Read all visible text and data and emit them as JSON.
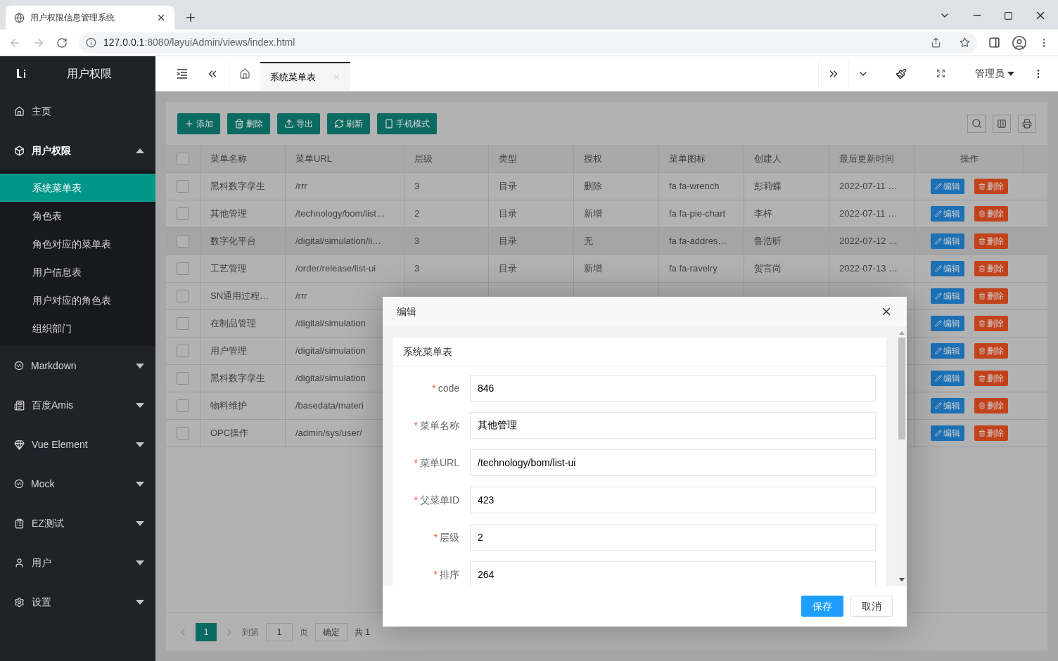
{
  "browser": {
    "tab_title": "用户权限信息管理系统",
    "url_host": "127.0.0.1",
    "url_path": ":8080/layuiAdmin/views/index.html"
  },
  "sidebar": {
    "title": "用户权限",
    "items": [
      {
        "label": "主页",
        "kind": "link"
      },
      {
        "label": "用户权限",
        "kind": "group",
        "expanded": true,
        "children": [
          {
            "label": "系统菜单表",
            "selected": true
          },
          {
            "label": "角色表",
            "selected": false
          },
          {
            "label": "角色对应的菜单表",
            "selected": false
          },
          {
            "label": "用户信息表",
            "selected": false
          },
          {
            "label": "用户对应的角色表",
            "selected": false
          },
          {
            "label": "组织部门",
            "selected": false
          }
        ]
      },
      {
        "label": "Markdown",
        "kind": "group",
        "expanded": false
      },
      {
        "label": "百度Amis",
        "kind": "group",
        "expanded": false
      },
      {
        "label": "Vue Element",
        "kind": "group",
        "expanded": false
      },
      {
        "label": "Mock",
        "kind": "group",
        "expanded": false
      },
      {
        "label": "EZ测试",
        "kind": "group",
        "expanded": false
      },
      {
        "label": "用户",
        "kind": "group",
        "expanded": false
      },
      {
        "label": "设置",
        "kind": "group",
        "expanded": false
      }
    ]
  },
  "header": {
    "tabs": [
      {
        "label": "系统菜单表",
        "selected": true
      }
    ],
    "user": "管理员"
  },
  "toolbar": [
    "添加",
    "删除",
    "导出",
    "刷新",
    "手机模式"
  ],
  "table": {
    "header_checked": false,
    "columns": [
      "菜单名称",
      "菜单URL",
      "层级",
      "类型",
      "授权",
      "菜单图标",
      "创建人",
      "最后更新时间",
      "操作"
    ],
    "rows": [
      {
        "checked": false,
        "hovered": false,
        "cells": [
          "黑科数字孪生",
          "/rrr",
          "3",
          "目录",
          "删除",
          "fa fa-wrench",
          "彭莉蝶",
          "2022-07-11 …"
        ],
        "actions": [
          "编辑",
          "删除"
        ]
      },
      {
        "checked": false,
        "hovered": false,
        "cells": [
          "其他管理",
          "/technology/bom/list…",
          "2",
          "目录",
          "新增",
          "fa fa-pie-chart",
          "李梓",
          "2022-07-11 …"
        ],
        "actions": [
          "编辑",
          "删除"
        ]
      },
      {
        "checked": false,
        "hovered": true,
        "cells": [
          "数字化平台",
          "/digital/simulation/li…",
          "3",
          "目录",
          "无",
          "fa fa-addres…",
          "鲁浩昕",
          "2022-07-12 …"
        ],
        "actions": [
          "编辑",
          "删除"
        ]
      },
      {
        "checked": false,
        "hovered": false,
        "cells": [
          "工艺管理",
          "/order/release/list-ui",
          "3",
          "目录",
          "新增",
          "fa fa-ravelry",
          "贺言尚",
          "2022-07-13 …"
        ],
        "actions": [
          "编辑",
          "删除"
        ]
      },
      {
        "checked": false,
        "hovered": false,
        "cells": [
          "SN通用过程…",
          "/rrr"
        ],
        "actions": [
          "编辑",
          "删除"
        ]
      },
      {
        "checked": false,
        "hovered": false,
        "cells": [
          "在制品管理",
          "/digital/simulation"
        ],
        "actions": [
          "编辑",
          "删除"
        ]
      },
      {
        "checked": false,
        "hovered": false,
        "cells": [
          "用户管理",
          "/digital/simulation"
        ],
        "actions": [
          "编辑",
          "删除"
        ]
      },
      {
        "checked": false,
        "hovered": false,
        "cells": [
          "黑科数字孪生",
          "/digital/simulation"
        ],
        "actions": [
          "编辑",
          "删除"
        ]
      },
      {
        "checked": false,
        "hovered": false,
        "cells": [
          "物料维护",
          "/basedata/materi"
        ],
        "actions": [
          "编辑",
          "删除"
        ]
      },
      {
        "checked": false,
        "hovered": false,
        "cells": [
          "OPC操作",
          "/admin/sys/user/"
        ],
        "actions": [
          "编辑",
          "删除"
        ]
      }
    ]
  },
  "pagination": {
    "pages": [
      {
        "label": "1",
        "selected": true
      }
    ],
    "goto_label": "到第",
    "goto_value": "1",
    "page_unit": "页",
    "confirm": "确定",
    "total": "共 1"
  },
  "dialog": {
    "title": "编辑",
    "section_title": "系统菜单表",
    "fields": [
      {
        "label": "code",
        "value": "846",
        "required_mark": "*"
      },
      {
        "label": "菜单名称",
        "value": "其他管理",
        "required_mark": "*"
      },
      {
        "label": "菜单URL",
        "value": "/technology/bom/list-ui",
        "required_mark": "*"
      },
      {
        "label": "父菜单ID",
        "value": "423",
        "required_mark": "*"
      },
      {
        "label": "层级",
        "value": "2",
        "required_mark": "*"
      },
      {
        "label": "排序",
        "value": "264",
        "required_mark": "*"
      }
    ],
    "buttons": [
      {
        "label": "保存",
        "kind": "primary"
      },
      {
        "label": "取消",
        "kind": "default"
      }
    ]
  }
}
